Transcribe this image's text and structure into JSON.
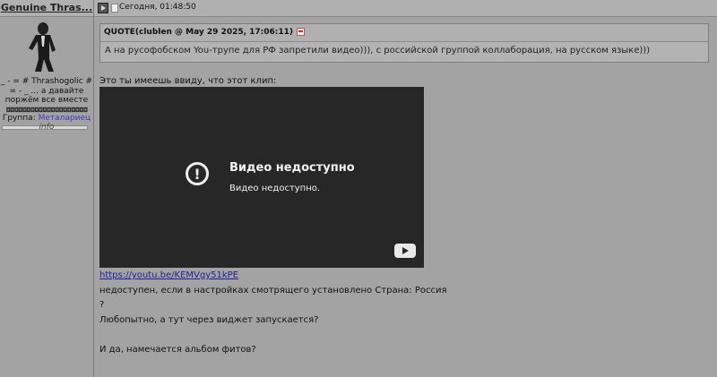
{
  "author": {
    "name": "Genuine Thras...",
    "status_line": "_ - = # Thrashogolic # = - _ ... а давайте поржём все вместе",
    "rank_glyphs": "◘◘◘◘◘◘◘◘◘◘◘◘◘◘◘◘◘◘◘◘",
    "group_label": "Группа:",
    "group_value": "Металариец",
    "profile_link": "info"
  },
  "post": {
    "time": "Сегодня, 01:48:50",
    "quote": {
      "header": "QUOTE(clublen @ May 29 2025, 17:06:11)",
      "text": "А на русофобском You-трупе для РФ запретили видео))), с российской группой коллаборация, на русском языке)))"
    },
    "intro": "Это ты имеешь ввиду, что этот клип:",
    "video": {
      "title": "Видео недоступно",
      "subtitle": "Видео недоступно.",
      "error_icon": "exclamation-circle-icon",
      "logo_icon": "youtube-icon"
    },
    "link": "https://youtu.be/KEMVgy51kPE",
    "lines": [
      "недоступен, если в настройках смотрящего установлено Страна: Россия",
      "?",
      "Любопытно, а тут через виджет запускается?",
      "",
      "И да, намечается альбом фитов?"
    ]
  }
}
